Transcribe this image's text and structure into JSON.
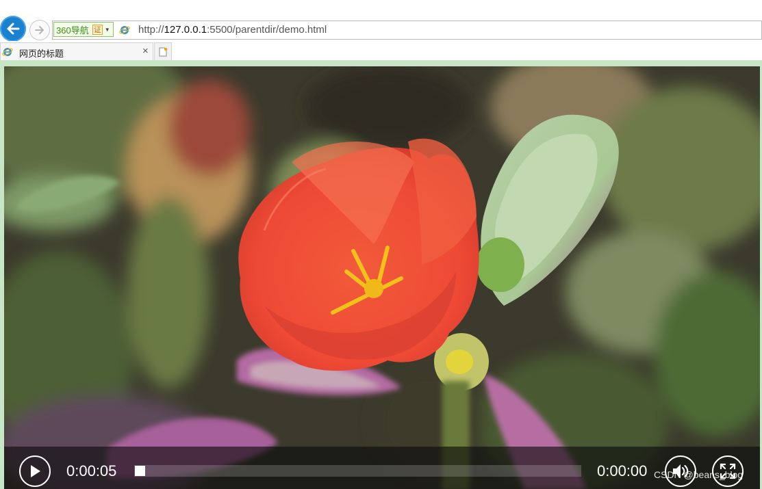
{
  "browser": {
    "address_bar": {
      "nav360_label": "360导航",
      "cert_label": "证",
      "url_prefix": "http://",
      "url_host": "127.0.0.1",
      "url_rest": ":5500/parentdir/demo.html"
    },
    "tab": {
      "title": "网页的标题",
      "close_glyph": "×"
    }
  },
  "video": {
    "current_time": "0:00:05",
    "duration": "0:00:00",
    "progress_fraction": 0
  },
  "watermark": "CSDN @beans_blog"
}
